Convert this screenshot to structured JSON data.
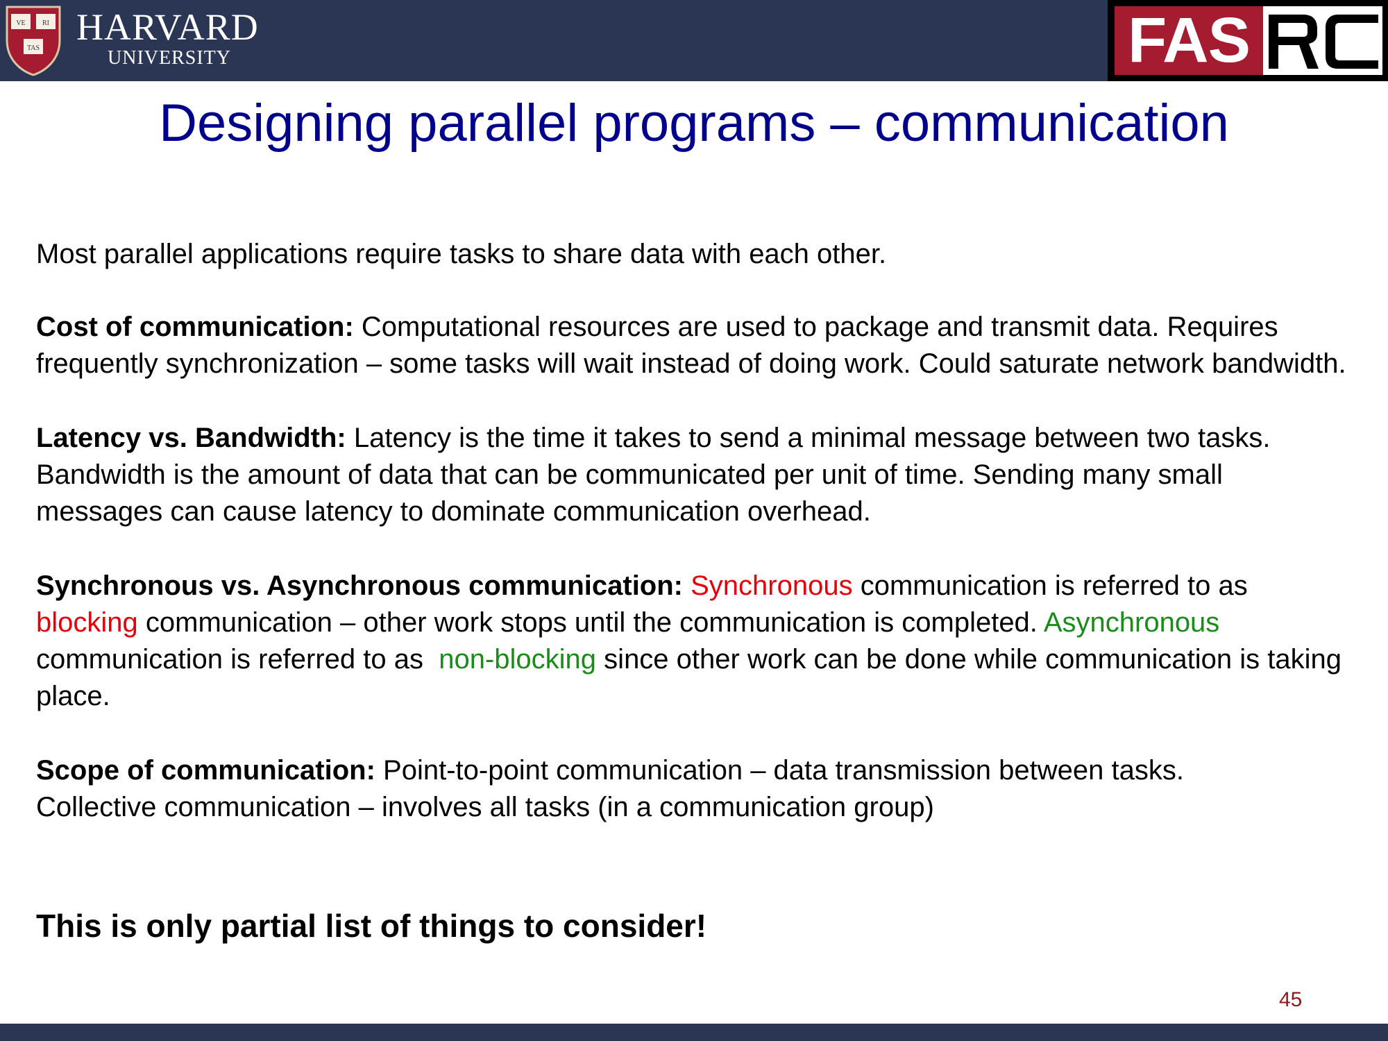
{
  "header": {
    "logo_title": "HARVARD",
    "logo_subtitle": "UNIVERSITY",
    "shield_lettering": "VE RI TAS",
    "fasrc_left": "FAS",
    "fasrc_right": "RC",
    "colors": {
      "bar": "#2b3554",
      "crimson": "#a51c30"
    }
  },
  "slide": {
    "title": "Designing parallel programs – communication",
    "intro": "Most parallel applications require tasks to share data with each other.",
    "cost": {
      "heading": "Cost of communication:",
      "text": " Computational resources are used to package and transmit data. Requires frequently synchronization – some tasks will wait instead of doing work. Could saturate network bandwidth."
    },
    "latency": {
      "heading": "Latency vs. Bandwidth:",
      "text": " Latency is the time it takes to send a minimal message between two tasks. Bandwidth is the amount of data that can be communicated per unit of time. Sending many small messages can cause latency to dominate communication overhead."
    },
    "sync": {
      "heading": "Synchronous vs. Asynchronous communication:",
      "word_sync": "Synchronous",
      "text1": " communication is referred to as ",
      "word_blocking": "blocking",
      "text2": " communication – other work stops until the communication is completed. ",
      "word_async": "Asynchronous",
      "text3": " communication is referred to as  ",
      "word_nonblocking": "non-blocking",
      "text4": " since other work can be done while communication is taking place."
    },
    "scope": {
      "heading": "Scope of communication:",
      "line1": " Point-to-point communication – data transmission between tasks.",
      "line2": "Collective communication – involves all tasks (in a communication group)"
    },
    "closing": "This is only partial list of things to consider!",
    "page_number": "45",
    "colors": {
      "title": "#00008b",
      "highlight_red": "#e3000b",
      "highlight_green": "#1a8c1a"
    }
  }
}
